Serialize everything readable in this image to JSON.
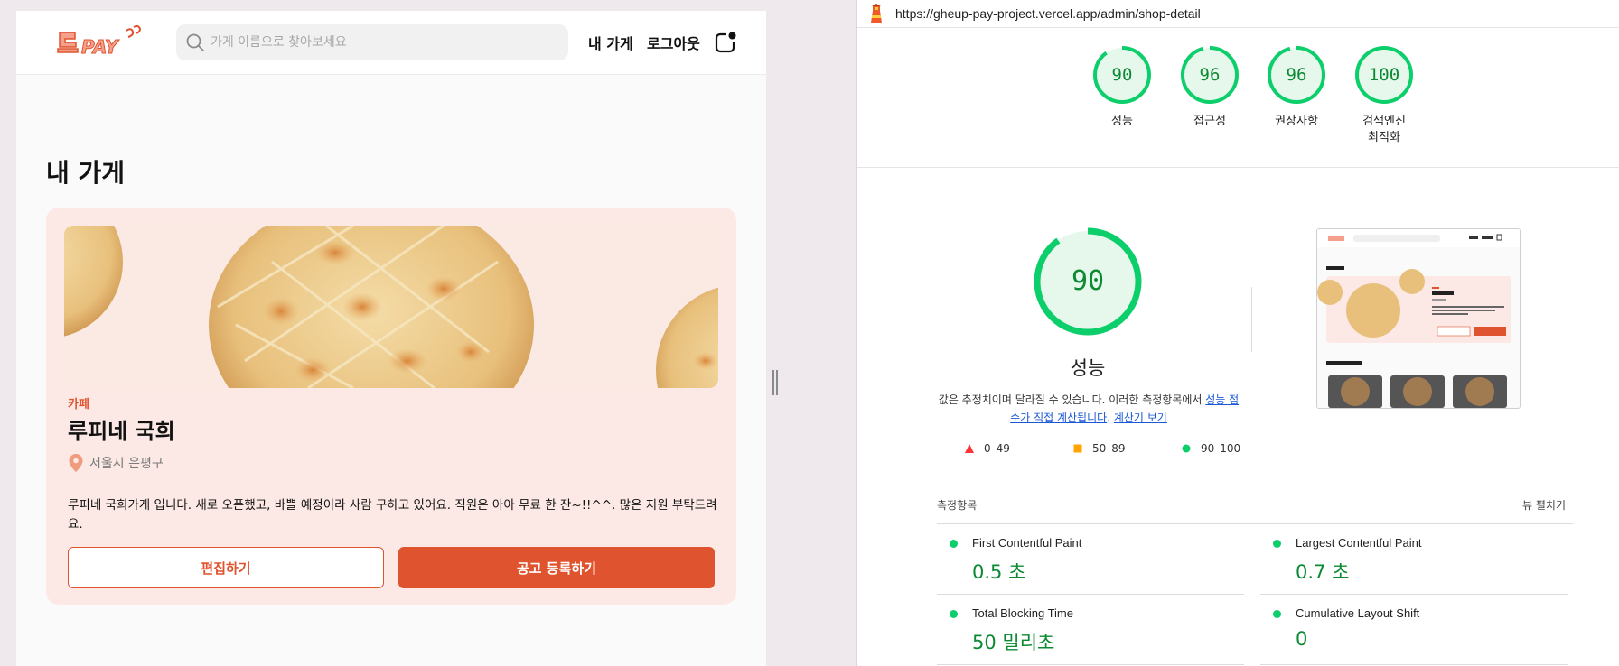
{
  "app": {
    "logo_text": "급PAY",
    "search": {
      "placeholder": "가게 이름으로 찾아보세요",
      "value": ""
    },
    "nav": {
      "my_shop": "내 가게",
      "logout": "로그아웃"
    },
    "page_title": "내 가게",
    "shop": {
      "category": "카페",
      "name": "루피네 국희",
      "address": "서울시 은평구",
      "description": "루피네 국희가게 입니다. 새로 오픈했고, 바쁠 예정이라 사람 구하고 있어요. 직원은 아아 무료 한 잔~!!^^. 많은 지원 부탁드려요.",
      "edit_label": "편집하기",
      "post_job_label": "공고 등록하기"
    },
    "colors": {
      "primary": "#e0532f",
      "card_bg": "#fce9e5"
    }
  },
  "lighthouse": {
    "url": "https://gheup-pay-project.vercel.app/admin/shop-detail",
    "scores": [
      {
        "label": "성능",
        "value": "90"
      },
      {
        "label": "접근성",
        "value": "96"
      },
      {
        "label": "권장사항",
        "value": "96"
      },
      {
        "label": "검색엔진\n최적화",
        "value": "100"
      }
    ],
    "main": {
      "score": "90",
      "title": "성능",
      "note_text": "값은 추정치이며 달라질 수 있습니다. 이러한 측정항목에서 ",
      "note_link1": "성능 점수가 직접 계산됩니다",
      "note_sep": ". ",
      "note_link2": "계산기 보기"
    },
    "legend": [
      {
        "range": "0–49",
        "shape": "triangle",
        "color": "#ff3333"
      },
      {
        "range": "50–89",
        "shape": "square",
        "color": "#ffa400"
      },
      {
        "range": "90–100",
        "shape": "circle",
        "color": "#0cce6b"
      }
    ],
    "metrics_title": "측정항목",
    "expand_label": "뷰 펼치기",
    "metrics": [
      {
        "name": "First Contentful Paint",
        "value": "0.5 초"
      },
      {
        "name": "Largest Contentful Paint",
        "value": "0.7 초"
      },
      {
        "name": "Total Blocking Time",
        "value": "50 밀리초"
      },
      {
        "name": "Cumulative Layout Shift",
        "value": "0"
      }
    ],
    "colors": {
      "pass": "#0cce6b",
      "pass_text": "#0c8a33",
      "gauge_bg": "#e6f7ec"
    }
  }
}
